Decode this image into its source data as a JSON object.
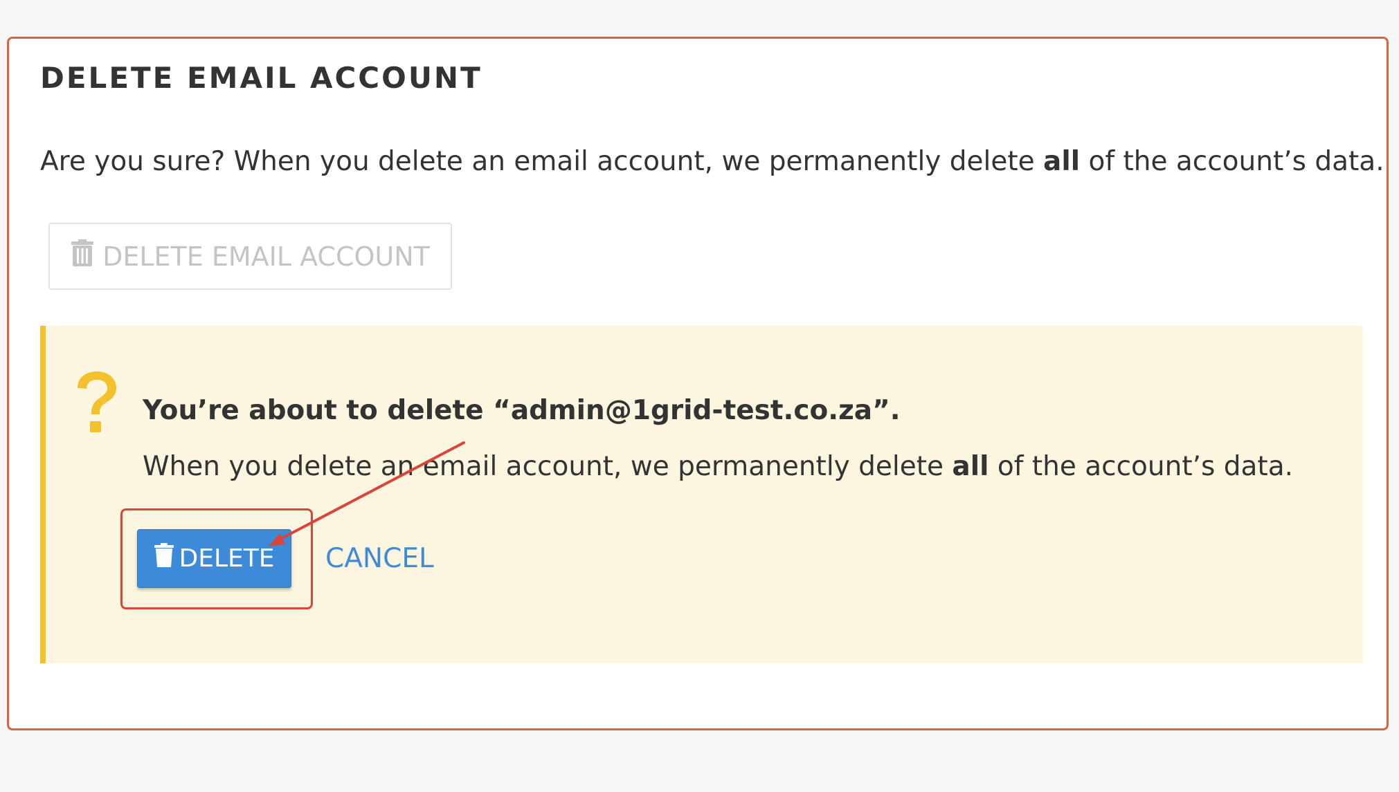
{
  "panel": {
    "title": "DELETE EMAIL ACCOUNT",
    "intro_before": "Are you sure? When you delete an email account, we permanently delete ",
    "intro_bold": "all",
    "intro_after": " of the account’s data.",
    "delete_account_button_label": "DELETE EMAIL ACCOUNT",
    "delete_account_button_disabled": true
  },
  "confirmation": {
    "icon": "question-mark-icon",
    "title": "You’re about to delete “admin@1grid-test.co.za”.",
    "desc_before": "When you delete an email account, we permanently delete ",
    "desc_bold": "all",
    "desc_after": " of the account’s data.",
    "delete_button_label": "DELETE",
    "cancel_label": "CANCEL"
  },
  "colors": {
    "panel_border": "#d9643a",
    "warning_background": "#fcf6e0",
    "warning_accent": "#f3c12d",
    "primary_button": "#3d8bd8",
    "annotation": "#d9453a"
  }
}
